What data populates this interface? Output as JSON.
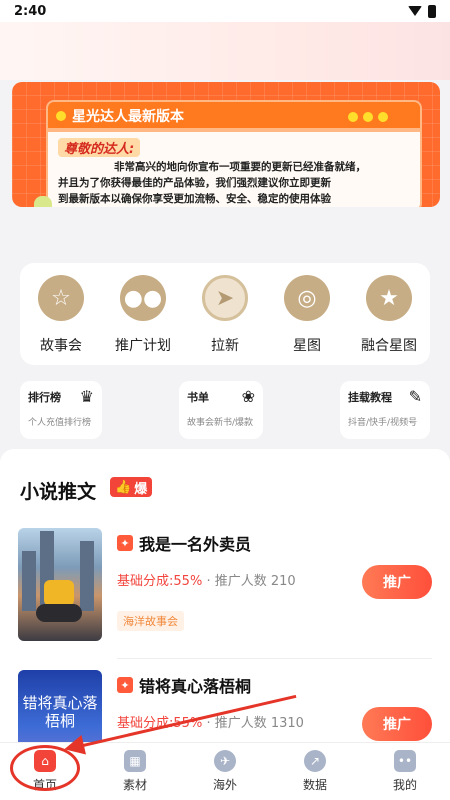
{
  "status_bar": {
    "time": "2:40"
  },
  "banner": {
    "title": "星光达人最新版本",
    "greeting": "尊敬的达人:",
    "line1": "非常高兴的地向你宣布一项重要的更新已经准备就绪，",
    "line2": "并且为了你获得最佳的产品体验，我们强烈建议你立即更新",
    "line3": "到最新版本以确保你享受更加流畅、安全、稳定的使用体验"
  },
  "shortcuts": [
    {
      "label": "故事会",
      "icon": "story-icon"
    },
    {
      "label": "推广计划",
      "icon": "people-icon"
    },
    {
      "label": "拉新",
      "icon": "paper-plane-icon"
    },
    {
      "label": "星图",
      "icon": "planet-icon"
    },
    {
      "label": "融合星图",
      "icon": "star-icon"
    }
  ],
  "mini_cards": [
    {
      "title": "排行榜",
      "subtitle": "个人充值排行榜",
      "icon": "crown-icon"
    },
    {
      "title": "书单",
      "subtitle": "故事会新书/爆款",
      "icon": "books-icon"
    },
    {
      "title": "挂载教程",
      "subtitle": "抖音/快手/视频号",
      "icon": "tutorial-icon"
    }
  ],
  "section": {
    "title": "小说推文",
    "badge": "爆"
  },
  "books": [
    {
      "title": "我是一名外卖员",
      "rate_label": "基础分成",
      "rate": ":55%",
      "sep": "·",
      "promoters": "推广人数 210",
      "tag": "海洋故事会",
      "button": "推广"
    },
    {
      "title": "错将真心落梧桐",
      "rate_label": "基础分成",
      "rate": ":55%",
      "sep": "·",
      "promoters": "推广人数 1310",
      "button": "推广",
      "cover_text": "错将真心落梧桐"
    }
  ],
  "tabbar": [
    {
      "label": "首页",
      "icon": "home-icon",
      "active": true
    },
    {
      "label": "素材",
      "icon": "material-icon"
    },
    {
      "label": "海外",
      "icon": "globe-icon"
    },
    {
      "label": "数据",
      "icon": "chart-icon"
    },
    {
      "label": "我的",
      "icon": "profile-icon"
    }
  ],
  "colors": {
    "accent": "#f24438",
    "gold": "#c7ad85",
    "banner_orange": "#ff6a2d"
  }
}
